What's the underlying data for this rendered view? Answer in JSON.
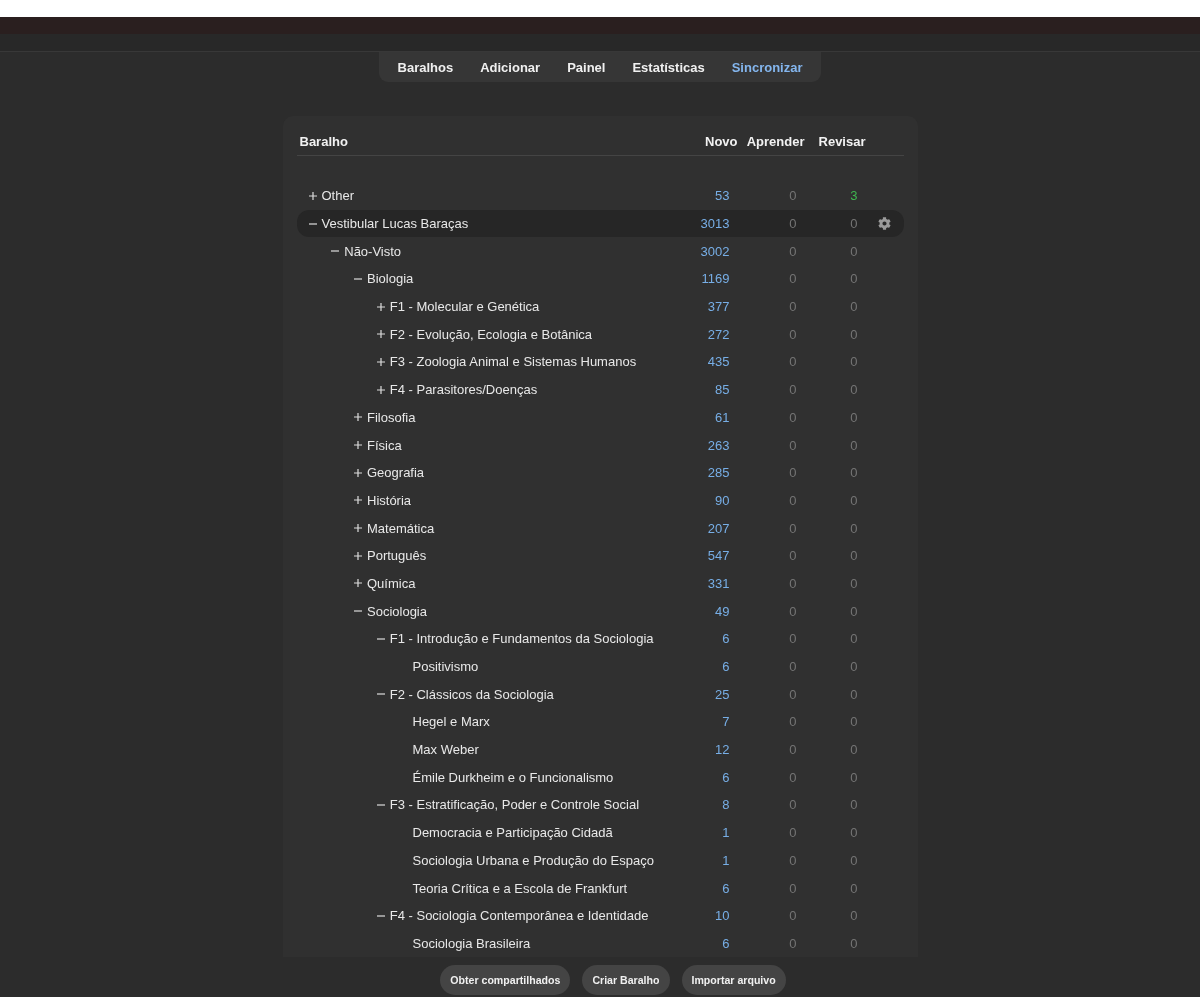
{
  "tabs": [
    {
      "label": "Baralhos",
      "highlighted": false
    },
    {
      "label": "Adicionar",
      "highlighted": false
    },
    {
      "label": "Painel",
      "highlighted": false
    },
    {
      "label": "Estatísticas",
      "highlighted": false
    },
    {
      "label": "Sincronizar",
      "highlighted": true
    }
  ],
  "deck_table": {
    "columns": [
      "Baralho",
      "Novo",
      "Aprender",
      "Revisar"
    ],
    "decks": [
      {
        "name": "Other",
        "kind": "group",
        "expanded": false,
        "selected": false,
        "counts": [
          {
            "text": "53",
            "dimmed": false
          },
          {
            "text": "0",
            "dimmed": true
          },
          {
            "text": "3",
            "dimmed": false
          }
        ]
      },
      {
        "name": "Vestibular Lucas Baraças",
        "kind": "group",
        "expanded": true,
        "selected": true,
        "counts": [
          {
            "text": "3013",
            "dimmed": false
          },
          {
            "text": "0",
            "dimmed": true
          },
          {
            "text": "0",
            "dimmed": true
          }
        ],
        "children": [
          {
            "name": "Não-Visto",
            "kind": "group",
            "expanded": true,
            "selected": false,
            "counts": [
              {
                "text": "3002",
                "dimmed": false
              },
              {
                "text": "0",
                "dimmed": true
              },
              {
                "text": "0",
                "dimmed": true
              }
            ],
            "children": [
              {
                "name": "Biologia",
                "kind": "group",
                "expanded": true,
                "selected": false,
                "counts": [
                  {
                    "text": "1169",
                    "dimmed": false
                  },
                  {
                    "text": "0",
                    "dimmed": true
                  },
                  {
                    "text": "0",
                    "dimmed": true
                  }
                ],
                "children": [
                  {
                    "name": "F1 - Molecular e Genética",
                    "kind": "group",
                    "expanded": false,
                    "selected": false,
                    "counts": [
                      {
                        "text": "377",
                        "dimmed": false
                      },
                      {
                        "text": "0",
                        "dimmed": true
                      },
                      {
                        "text": "0",
                        "dimmed": true
                      }
                    ]
                  },
                  {
                    "name": "F2 - Evolução, Ecologia e Botânica",
                    "kind": "group",
                    "expanded": false,
                    "selected": false,
                    "counts": [
                      {
                        "text": "272",
                        "dimmed": false
                      },
                      {
                        "text": "0",
                        "dimmed": true
                      },
                      {
                        "text": "0",
                        "dimmed": true
                      }
                    ]
                  },
                  {
                    "name": "F3 - Zoologia Animal e Sistemas Humanos",
                    "kind": "group",
                    "expanded": false,
                    "selected": false,
                    "counts": [
                      {
                        "text": "435",
                        "dimmed": false
                      },
                      {
                        "text": "0",
                        "dimmed": true
                      },
                      {
                        "text": "0",
                        "dimmed": true
                      }
                    ]
                  },
                  {
                    "name": "F4 - Parasitores/Doenças",
                    "kind": "group",
                    "expanded": false,
                    "selected": false,
                    "counts": [
                      {
                        "text": "85",
                        "dimmed": false
                      },
                      {
                        "text": "0",
                        "dimmed": true
                      },
                      {
                        "text": "0",
                        "dimmed": true
                      }
                    ]
                  }
                ]
              },
              {
                "name": "Filosofia",
                "kind": "group",
                "expanded": false,
                "selected": false,
                "counts": [
                  {
                    "text": "61",
                    "dimmed": false
                  },
                  {
                    "text": "0",
                    "dimmed": true
                  },
                  {
                    "text": "0",
                    "dimmed": true
                  }
                ]
              },
              {
                "name": "Física",
                "kind": "group",
                "expanded": false,
                "selected": false,
                "counts": [
                  {
                    "text": "263",
                    "dimmed": false
                  },
                  {
                    "text": "0",
                    "dimmed": true
                  },
                  {
                    "text": "0",
                    "dimmed": true
                  }
                ]
              },
              {
                "name": "Geografia",
                "kind": "group",
                "expanded": false,
                "selected": false,
                "counts": [
                  {
                    "text": "285",
                    "dimmed": false
                  },
                  {
                    "text": "0",
                    "dimmed": true
                  },
                  {
                    "text": "0",
                    "dimmed": true
                  }
                ]
              },
              {
                "name": "História",
                "kind": "group",
                "expanded": false,
                "selected": false,
                "counts": [
                  {
                    "text": "90",
                    "dimmed": false
                  },
                  {
                    "text": "0",
                    "dimmed": true
                  },
                  {
                    "text": "0",
                    "dimmed": true
                  }
                ]
              },
              {
                "name": "Matemática",
                "kind": "group",
                "expanded": false,
                "selected": false,
                "counts": [
                  {
                    "text": "207",
                    "dimmed": false
                  },
                  {
                    "text": "0",
                    "dimmed": true
                  },
                  {
                    "text": "0",
                    "dimmed": true
                  }
                ]
              },
              {
                "name": "Português",
                "kind": "group",
                "expanded": false,
                "selected": false,
                "counts": [
                  {
                    "text": "547",
                    "dimmed": false
                  },
                  {
                    "text": "0",
                    "dimmed": true
                  },
                  {
                    "text": "0",
                    "dimmed": true
                  }
                ]
              },
              {
                "name": "Química",
                "kind": "group",
                "expanded": false,
                "selected": false,
                "counts": [
                  {
                    "text": "331",
                    "dimmed": false
                  },
                  {
                    "text": "0",
                    "dimmed": true
                  },
                  {
                    "text": "0",
                    "dimmed": true
                  }
                ]
              },
              {
                "name": "Sociologia",
                "kind": "group",
                "expanded": true,
                "selected": false,
                "counts": [
                  {
                    "text": "49",
                    "dimmed": false
                  },
                  {
                    "text": "0",
                    "dimmed": true
                  },
                  {
                    "text": "0",
                    "dimmed": true
                  }
                ],
                "children": [
                  {
                    "name": "F1 - Introdução e Fundamentos da Sociologia",
                    "kind": "group",
                    "expanded": true,
                    "selected": false,
                    "counts": [
                      {
                        "text": "6",
                        "dimmed": false
                      },
                      {
                        "text": "0",
                        "dimmed": true
                      },
                      {
                        "text": "0",
                        "dimmed": true
                      }
                    ],
                    "children": [
                      {
                        "name": "Positivismo",
                        "kind": "leaf",
                        "selected": false,
                        "counts": [
                          {
                            "text": "6",
                            "dimmed": false
                          },
                          {
                            "text": "0",
                            "dimmed": true
                          },
                          {
                            "text": "0",
                            "dimmed": true
                          }
                        ]
                      }
                    ]
                  },
                  {
                    "name": "F2 - Clássicos da Sociologia",
                    "kind": "group",
                    "expanded": true,
                    "selected": false,
                    "counts": [
                      {
                        "text": "25",
                        "dimmed": false
                      },
                      {
                        "text": "0",
                        "dimmed": true
                      },
                      {
                        "text": "0",
                        "dimmed": true
                      }
                    ],
                    "children": [
                      {
                        "name": "Hegel e Marx",
                        "kind": "leaf",
                        "selected": false,
                        "counts": [
                          {
                            "text": "7",
                            "dimmed": false
                          },
                          {
                            "text": "0",
                            "dimmed": true
                          },
                          {
                            "text": "0",
                            "dimmed": true
                          }
                        ]
                      },
                      {
                        "name": "Max Weber",
                        "kind": "leaf",
                        "selected": false,
                        "counts": [
                          {
                            "text": "12",
                            "dimmed": false
                          },
                          {
                            "text": "0",
                            "dimmed": true
                          },
                          {
                            "text": "0",
                            "dimmed": true
                          }
                        ]
                      },
                      {
                        "name": "Émile Durkheim e o Funcionalismo",
                        "kind": "leaf",
                        "selected": false,
                        "counts": [
                          {
                            "text": "6",
                            "dimmed": false
                          },
                          {
                            "text": "0",
                            "dimmed": true
                          },
                          {
                            "text": "0",
                            "dimmed": true
                          }
                        ]
                      }
                    ]
                  },
                  {
                    "name": "F3 - Estratificação, Poder e Controle Social",
                    "kind": "group",
                    "expanded": true,
                    "selected": false,
                    "counts": [
                      {
                        "text": "8",
                        "dimmed": false
                      },
                      {
                        "text": "0",
                        "dimmed": true
                      },
                      {
                        "text": "0",
                        "dimmed": true
                      }
                    ],
                    "children": [
                      {
                        "name": "Democracia e Participação Cidadã",
                        "kind": "leaf",
                        "selected": false,
                        "counts": [
                          {
                            "text": "1",
                            "dimmed": false
                          },
                          {
                            "text": "0",
                            "dimmed": true
                          },
                          {
                            "text": "0",
                            "dimmed": true
                          }
                        ]
                      },
                      {
                        "name": "Sociologia Urbana e Produção do Espaço",
                        "kind": "leaf",
                        "selected": false,
                        "counts": [
                          {
                            "text": "1",
                            "dimmed": false
                          },
                          {
                            "text": "0",
                            "dimmed": true
                          },
                          {
                            "text": "0",
                            "dimmed": true
                          }
                        ]
                      },
                      {
                        "name": "Teoria Crítica e a Escola de Frankfurt",
                        "kind": "leaf",
                        "selected": false,
                        "counts": [
                          {
                            "text": "6",
                            "dimmed": false
                          },
                          {
                            "text": "0",
                            "dimmed": true
                          },
                          {
                            "text": "0",
                            "dimmed": true
                          }
                        ]
                      }
                    ]
                  },
                  {
                    "name": "F4 - Sociologia Contemporânea e Identidade",
                    "kind": "group",
                    "expanded": true,
                    "selected": false,
                    "counts": [
                      {
                        "text": "10",
                        "dimmed": false
                      },
                      {
                        "text": "0",
                        "dimmed": true
                      },
                      {
                        "text": "0",
                        "dimmed": true
                      }
                    ],
                    "children": [
                      {
                        "name": "Sociologia Brasileira",
                        "kind": "leaf",
                        "selected": false,
                        "counts": [
                          {
                            "text": "6",
                            "dimmed": false
                          },
                          {
                            "text": "0",
                            "dimmed": true
                          },
                          {
                            "text": "0",
                            "dimmed": true
                          }
                        ]
                      }
                    ]
                  }
                ]
              }
            ]
          }
        ]
      }
    ]
  },
  "actions": [
    "Obter compartilhados",
    "Criar Baralho",
    "Importar arquivo"
  ]
}
